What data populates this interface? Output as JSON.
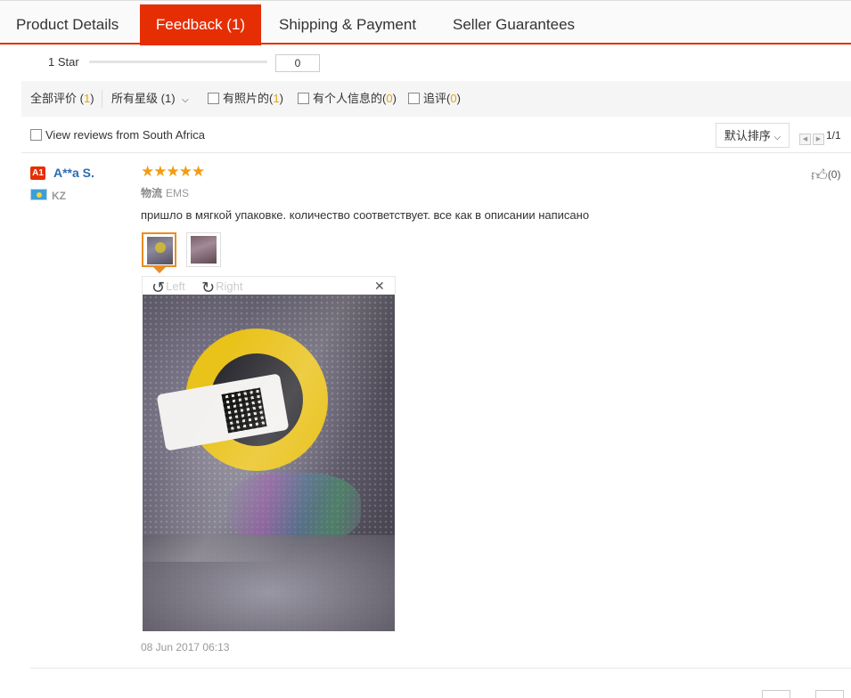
{
  "tabs": [
    {
      "label": "Product Details",
      "active": false
    },
    {
      "label": "Feedback (1)",
      "active": true
    },
    {
      "label": "Shipping & Payment",
      "active": false
    },
    {
      "label": "Seller Guarantees",
      "active": false
    }
  ],
  "rating_row": {
    "label": "1 Star",
    "count": "0"
  },
  "filters": {
    "all": {
      "label": "全部评价",
      "count": "1"
    },
    "stars": {
      "label": "所有星级",
      "count": "(1)"
    },
    "with_photos": {
      "label": "有照片的",
      "count": "1"
    },
    "with_info": {
      "label": "有个人信息的",
      "count": "0"
    },
    "follow_up": {
      "label": "追评",
      "count": "0"
    }
  },
  "south_africa_label": "View reviews from South Africa",
  "sort_label": "默认排序",
  "pager": {
    "text": "1/1"
  },
  "review": {
    "badge": "A1",
    "username": "A**a S.",
    "country": "KZ",
    "stars": "★★★★★",
    "rating": 5,
    "logistics_label": "物流",
    "logistics_value": "EMS",
    "text": "пришло в мягкой упаковке. количество соответствует. все как в описании написано",
    "rotate_left": "Left",
    "rotate_right": "Right",
    "date": "08 Jun 2017 06:13",
    "helpful_count": "(0)"
  },
  "icons": {
    "rotate_left": "rotate-left-icon",
    "rotate_right": "rotate-right-icon",
    "close": "close-icon",
    "thumbs_up": "thumbs-up-icon"
  },
  "colors": {
    "accent": "#e62e04",
    "stars": "#f39c12",
    "count": "#e8a200",
    "username": "#2b6cb0"
  }
}
